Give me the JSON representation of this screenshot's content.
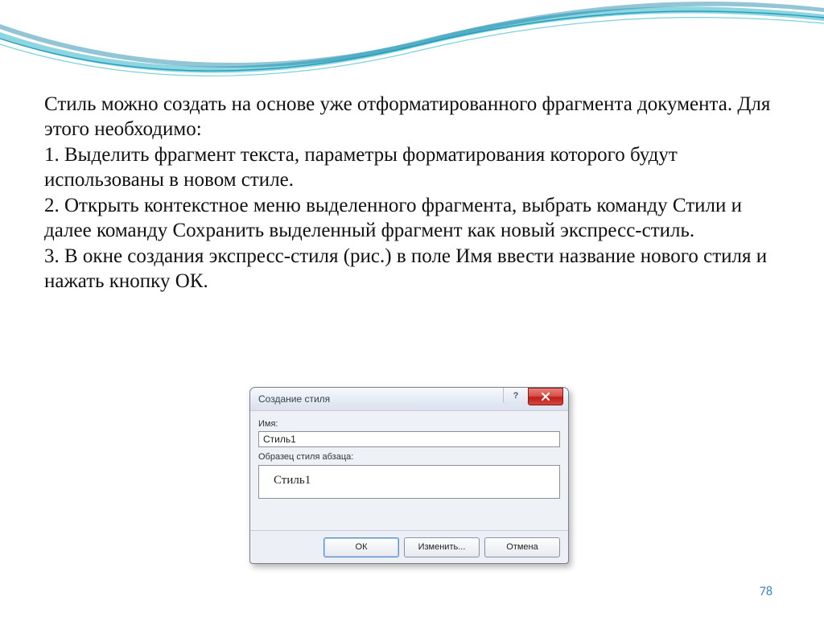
{
  "body": {
    "p1": "Стиль можно создать на основе уже отформатированного фрагмента документа. Для этого необходимо:",
    "p2": "1. Выделить фрагмент текста, параметры форматирования которого будут использованы в новом стиле.",
    "p3": "2. Открыть контекстное меню выделенного фрагмента, выбрать команду Стили и далее команду Сохранить выделенный фрагмент как новый экспресс-стиль.",
    "p4": "3. В окне создания экспресс-стиля (рис.) в поле Имя ввести название нового стиля и нажать кнопку ОК."
  },
  "dialog": {
    "title": "Создание стиля",
    "name_label": "Имя:",
    "name_value": "Стиль1",
    "preview_label": "Образец стиля абзаца:",
    "preview_text": "Стиль1",
    "buttons": {
      "ok": "ОК",
      "modify": "Изменить...",
      "cancel": "Отмена"
    },
    "help_glyph": "?"
  },
  "page_number": "78",
  "colors": {
    "page_number": "#3b88c3",
    "close_btn": "#c8453f"
  }
}
